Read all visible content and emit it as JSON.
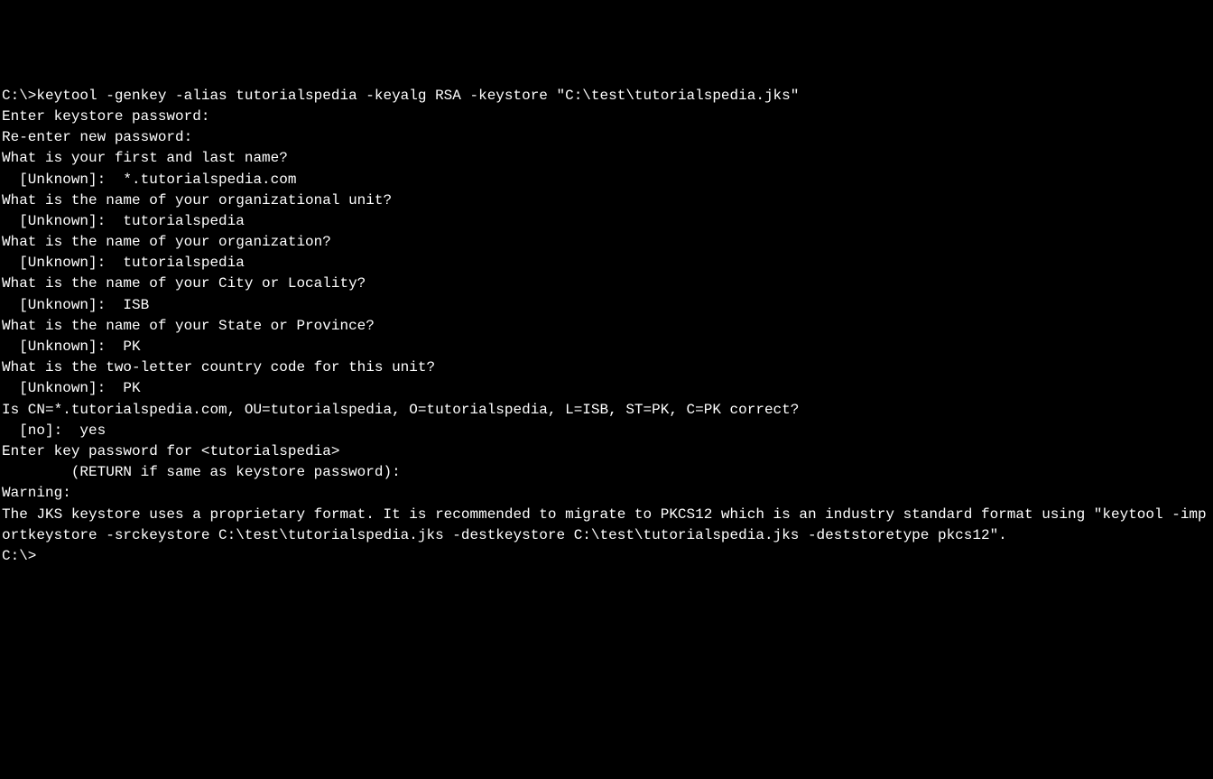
{
  "terminal": {
    "prompt1": "C:\\>",
    "command": "keytool -genkey -alias tutorialspedia -keyalg RSA -keystore \"C:\\test\\tutorialspedia.jks\"",
    "lines": [
      "Enter keystore password:",
      "Re-enter new password:",
      "What is your first and last name?",
      "  [Unknown]:  *.tutorialspedia.com",
      "What is the name of your organizational unit?",
      "  [Unknown]:  tutorialspedia",
      "What is the name of your organization?",
      "  [Unknown]:  tutorialspedia",
      "What is the name of your City or Locality?",
      "  [Unknown]:  ISB",
      "What is the name of your State or Province?",
      "  [Unknown]:  PK",
      "What is the two-letter country code for this unit?",
      "  [Unknown]:  PK",
      "Is CN=*.tutorialspedia.com, OU=tutorialspedia, O=tutorialspedia, L=ISB, ST=PK, C=PK correct?",
      "  [no]:  yes",
      "",
      "Enter key password for <tutorialspedia>",
      "        (RETURN if same as keystore password):",
      "",
      "Warning:",
      "The JKS keystore uses a proprietary format. It is recommended to migrate to PKCS12 which is an industry standard format using \"keytool -importkeystore -srckeystore C:\\test\\tutorialspedia.jks -destkeystore C:\\test\\tutorialspedia.jks -deststoretype pkcs12\".",
      ""
    ],
    "prompt2": "C:\\>"
  }
}
